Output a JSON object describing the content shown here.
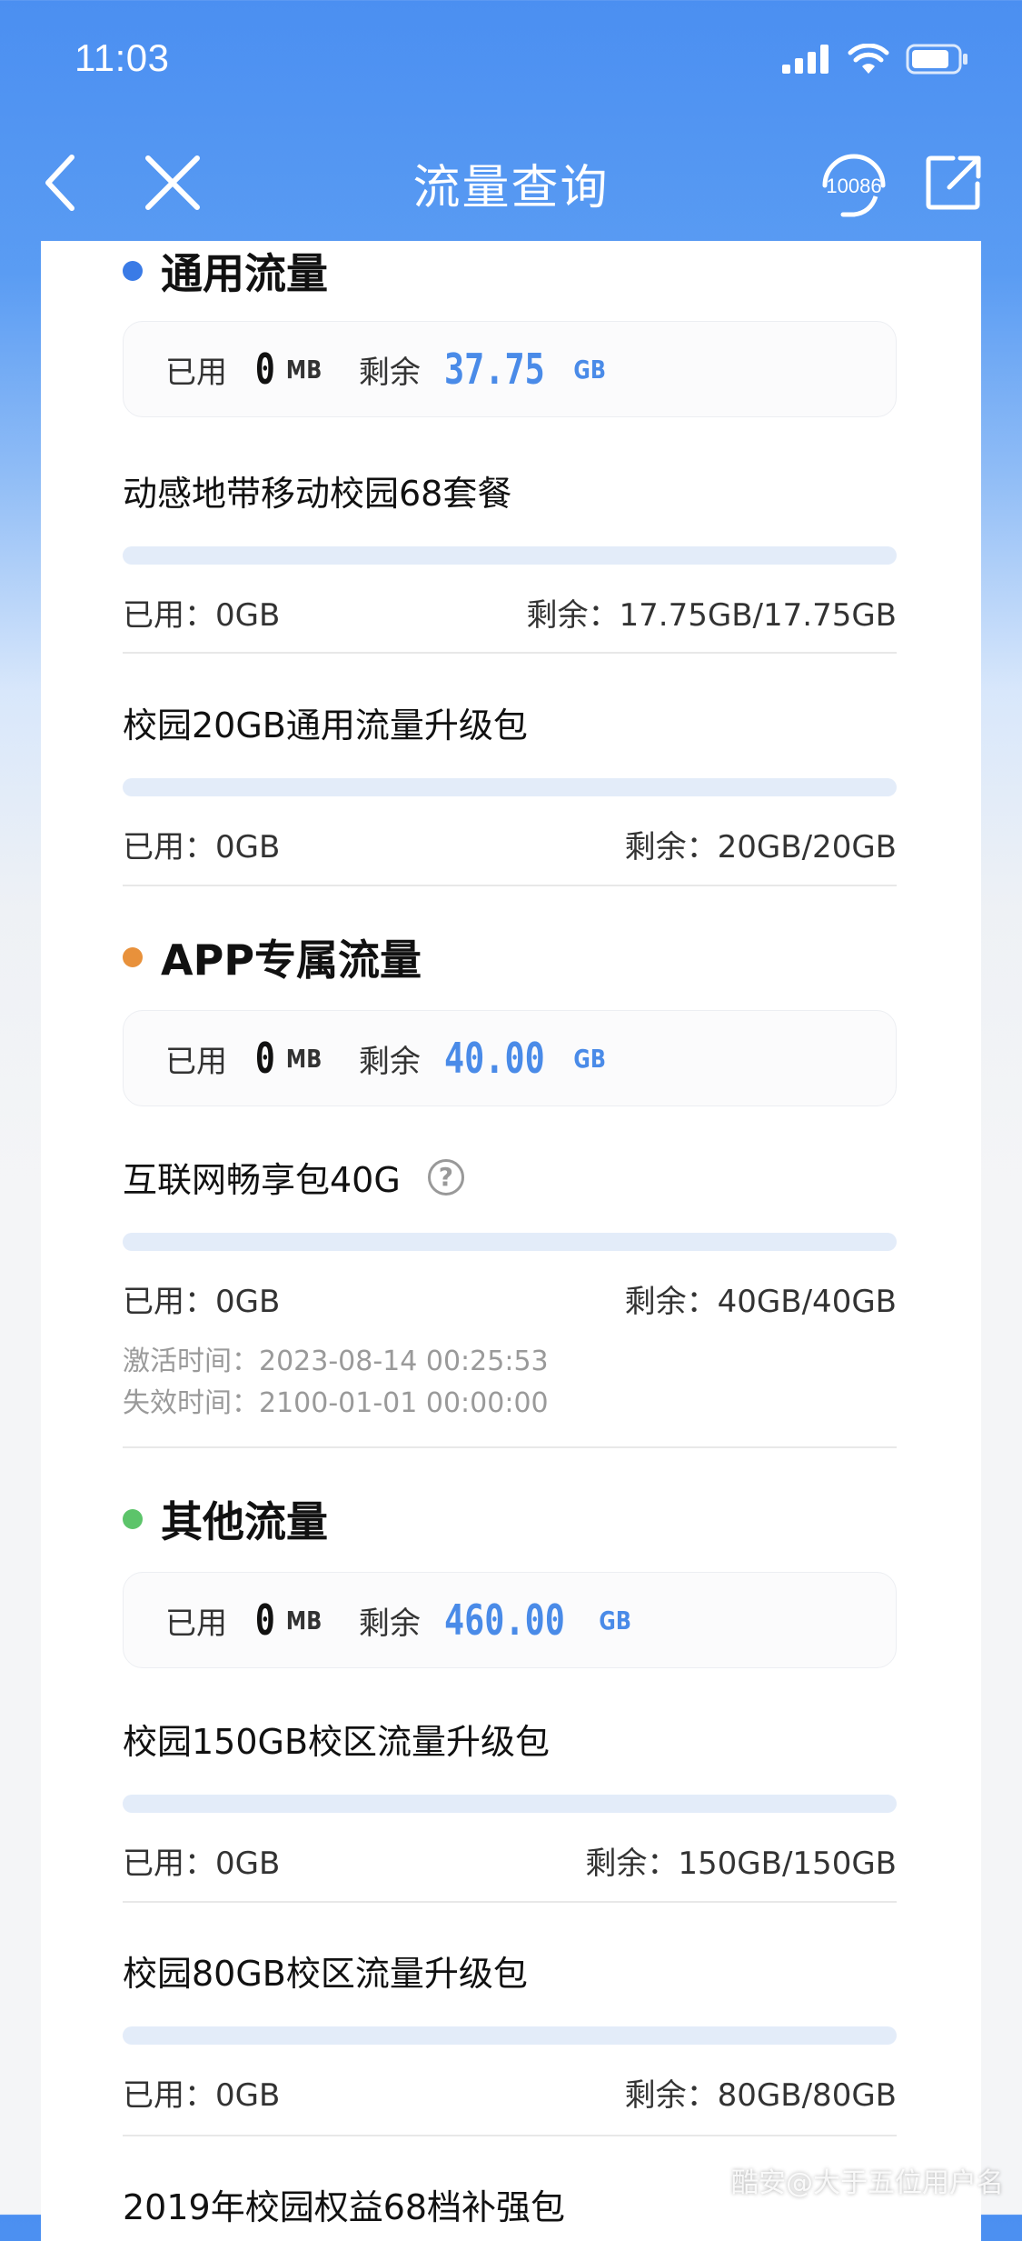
{
  "status_bar": {
    "time": "11:03"
  },
  "nav": {
    "title": "流量查询",
    "service_number": "10086"
  },
  "sections": [
    {
      "title": "通用流量",
      "dot_color": "#3a7be6",
      "summary": {
        "used_label": "已用",
        "used_value": "0",
        "used_unit": "MB",
        "remain_label": "剩余",
        "remain_value": "37.75",
        "remain_unit": "GB"
      },
      "packages": [
        {
          "name": "动感地带移动校园68套餐",
          "used": "已用：0GB",
          "remain": "剩余：17.75GB/17.75GB",
          "used_fraction": 0
        },
        {
          "name": "校园20GB通用流量升级包",
          "used": "已用：0GB",
          "remain": "剩余：20GB/20GB",
          "used_fraction": 0
        }
      ]
    },
    {
      "title": "APP专属流量",
      "dot_color": "#e8913b",
      "summary": {
        "used_label": "已用",
        "used_value": "0",
        "used_unit": "MB",
        "remain_label": "剩余",
        "remain_value": "40.00",
        "remain_unit": "GB"
      },
      "packages": [
        {
          "name": "互联网畅享包40G",
          "used": "已用：0GB",
          "remain": "剩余：40GB/40GB",
          "used_fraction": 0,
          "activated": "激活时间：2023-08-14 00:25:53",
          "expires": "失效时间：2100-01-01 00:00:00"
        }
      ]
    },
    {
      "title": "其他流量",
      "dot_color": "#5cc46a",
      "summary": {
        "used_label": "已用",
        "used_value": "0",
        "used_unit": "MB",
        "remain_label": "剩余",
        "remain_value": "460.00",
        "remain_unit": "GB"
      },
      "packages": [
        {
          "name": "校园150GB校区流量升级包",
          "used": "已用：0GB",
          "remain": "剩余：150GB/150GB",
          "used_fraction": 0
        },
        {
          "name": "校园80GB校区流量升级包",
          "used": "已用：0GB",
          "remain": "剩余：80GB/80GB",
          "used_fraction": 0
        },
        {
          "name": "2019年校园权益68档补强包"
        }
      ]
    }
  ],
  "watermark": "酷安@大于五位用户名"
}
